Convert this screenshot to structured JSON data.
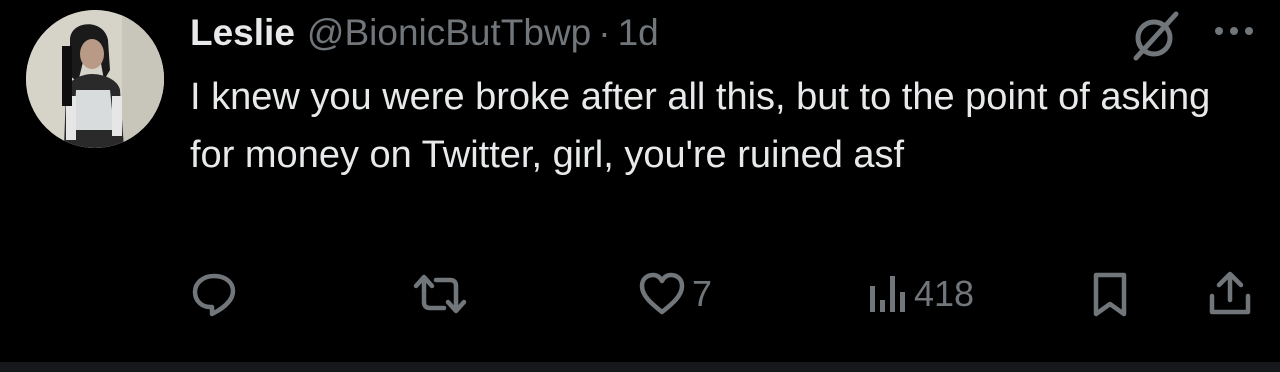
{
  "tweet": {
    "author_name": "Leslie",
    "handle": "@BionicButTbwp",
    "separator": "·",
    "time": "1d",
    "text": "I knew you were broke after all this, but to the point of asking for money on Twitter, girl, you're ruined asf",
    "avatar_icon": "profile-photo",
    "header_icons": [
      "grok-icon",
      "more-icon"
    ]
  },
  "actions": {
    "reply": {
      "icon": "reply-icon",
      "count": ""
    },
    "retweet": {
      "icon": "retweet-icon",
      "count": ""
    },
    "like": {
      "icon": "heart-icon",
      "count": "7"
    },
    "views": {
      "icon": "views-icon",
      "count": "418"
    },
    "bookmark": {
      "icon": "bookmark-icon",
      "count": ""
    },
    "share": {
      "icon": "share-icon",
      "count": ""
    }
  },
  "colors": {
    "background": "#000000",
    "text_primary": "#e7e9ea",
    "text_secondary": "#71767b"
  }
}
